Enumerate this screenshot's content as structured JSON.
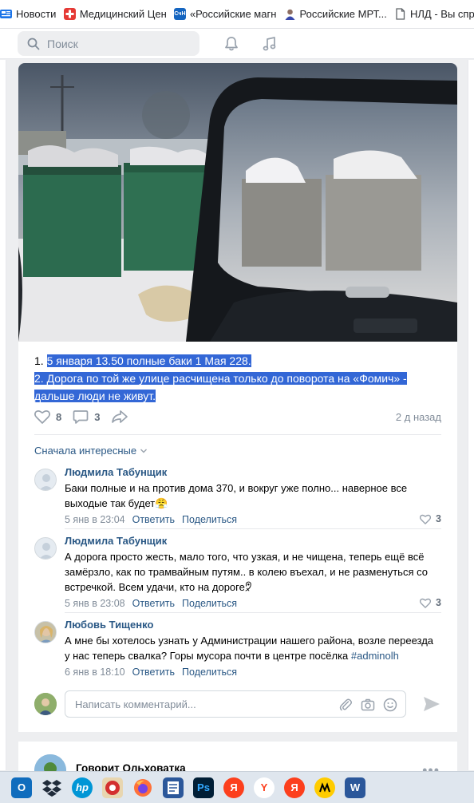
{
  "bookmarks": [
    {
      "label": "Новости",
      "icon": "news-favicon",
      "color": "#1a73e8"
    },
    {
      "label": "Медицинский Цен",
      "icon": "red-cross-favicon",
      "color": "#e53935"
    },
    {
      "label": "«Российские магн",
      "icon": "chn-favicon",
      "color": "#1565c0",
      "badge": "CчН"
    },
    {
      "label": "Российские МРТ...",
      "icon": "person-favicon",
      "color": "#5d4037"
    },
    {
      "label": "НЛД - Вы спр",
      "icon": "document-favicon",
      "color": "#5f6368"
    }
  ],
  "header": {
    "search_placeholder": "Поиск"
  },
  "post": {
    "text_line_1_prefix": "1. ",
    "text_line_1_selected": "5 января 13.50 полные баки 1 Мая 228.",
    "text_line_2": "2. Дорога по той же улице расчищена только до поворота на «Фомич» -",
    "text_line_3": "дальше люди не живут.",
    "likes": "8",
    "comments": "3",
    "time": "2 д назад"
  },
  "comments_section": {
    "sort_label": "Сначала интересные",
    "items": [
      {
        "author": "Людмила Табунщик",
        "text": "Баки полные и на против дома 370, и вокруг уже полно... наверное все выходые так будет😤",
        "date": "5 янв в 23:04",
        "reply": "Ответить",
        "share": "Поделиться",
        "likes": "3"
      },
      {
        "author": "Людмила Табунщик",
        "text": "А дорога просто жесть, мало того, что узкая, и не чищена, теперь ещё всё замёрзло, как по трамвайным путям.. в колею въехал, и не разменуться со встречкой. Всем удачи, кто на дороге🤋",
        "date": "5 янв в 23:08",
        "reply": "Ответить",
        "share": "Поделиться",
        "likes": "3"
      },
      {
        "author": "Любовь Тищенко",
        "text": "А мне бы хотелось узнать у Администрации нашего района, возле переезда у нас теперь свалка? Горы мусора почти в центре посёлка ",
        "hashtag": "#adminolh",
        "date": "6 янв в 18:10",
        "reply": "Ответить",
        "share": "Поделиться",
        "likes": ""
      }
    ],
    "input_placeholder": "Написать комментарий..."
  },
  "next_post": {
    "author": "Говорит Ольховатка",
    "menu": "•••"
  },
  "taskbar": [
    {
      "icon": "outlook-icon",
      "label": "O",
      "color": "#0f6cbd"
    },
    {
      "icon": "dropbox-icon",
      "label": "",
      "color": "#dfe6ee"
    },
    {
      "icon": "hp-icon",
      "label": "hp",
      "color": "#0096d6"
    },
    {
      "icon": "game-icon",
      "label": "",
      "color": "#dfe6ee"
    },
    {
      "icon": "firefox-icon",
      "label": "",
      "color": "#ff7139"
    },
    {
      "icon": "notepad-icon",
      "label": "",
      "color": "#2b579a"
    },
    {
      "icon": "photoshop-icon",
      "label": "Ps",
      "color": "#001e36"
    },
    {
      "icon": "yandex-icon",
      "label": "Я",
      "color": "#fc3f1d"
    },
    {
      "icon": "yandex-browser-icon",
      "label": "Y",
      "color": "#ffffff"
    },
    {
      "icon": "yandex-icon-2",
      "label": "Я",
      "color": "#fc3f1d"
    },
    {
      "icon": "yandex-music-icon",
      "label": "",
      "color": "#ffcc00"
    },
    {
      "icon": "word-icon",
      "label": "W",
      "color": "#2b579a"
    }
  ],
  "colors": {
    "link": "#2a5885",
    "selection": "#3367d6",
    "secondary_text": "#818c99",
    "background": "#edeef0"
  }
}
